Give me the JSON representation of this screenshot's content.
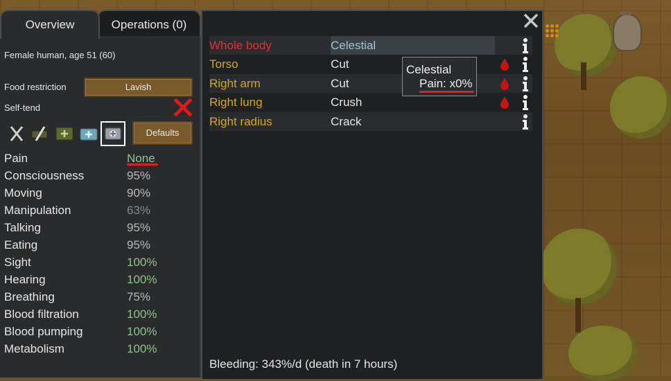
{
  "tabs": {
    "overview": "Overview",
    "operations": "Operations (0)"
  },
  "pawn": {
    "description": "Female human, age 51 (60)"
  },
  "food_restriction": {
    "label": "Food restriction",
    "value": "Lavish"
  },
  "self_tend": {
    "label": "Self-tend"
  },
  "medicine": {
    "icons": [
      "no-care-icon",
      "no-meds-icon",
      "herbal-medicine-icon",
      "industrial-medicine-icon",
      "glitterworld-medicine-icon"
    ],
    "defaults_label": "Defaults"
  },
  "capacities": [
    {
      "label": "Pain",
      "value": "None",
      "color": "#8fc28f"
    },
    {
      "label": "Consciousness",
      "value": "95%",
      "color": "#b8b8b8"
    },
    {
      "label": "Moving",
      "value": "90%",
      "color": "#b8b8b8"
    },
    {
      "label": "Manipulation",
      "value": "63%",
      "color": "#8a8a8a"
    },
    {
      "label": "Talking",
      "value": "95%",
      "color": "#b8b8b8"
    },
    {
      "label": "Eating",
      "value": "95%",
      "color": "#b8b8b8"
    },
    {
      "label": "Sight",
      "value": "100%",
      "color": "#8fc28f"
    },
    {
      "label": "Hearing",
      "value": "100%",
      "color": "#8fc28f"
    },
    {
      "label": "Breathing",
      "value": "75%",
      "color": "#b8b8b8"
    },
    {
      "label": "Blood filtration",
      "value": "100%",
      "color": "#8fc28f"
    },
    {
      "label": "Blood pumping",
      "value": "100%",
      "color": "#8fc28f"
    },
    {
      "label": "Metabolism",
      "value": "100%",
      "color": "#8fc28f"
    }
  ],
  "health": {
    "rows": [
      {
        "part": "Whole body",
        "condition": "Celestial",
        "part_color": "#e03030",
        "bleeding": false
      },
      {
        "part": "Torso",
        "condition": "Cut",
        "part_color": "#d4a81c",
        "bleeding": true
      },
      {
        "part": "Right arm",
        "condition": "Cut",
        "part_color": "#d4a81c",
        "bleeding": true
      },
      {
        "part": "Right lung",
        "condition": "Crush",
        "part_color": "#d4a81c",
        "bleeding": true
      },
      {
        "part": "Right radius",
        "condition": "Crack",
        "part_color": "#d4a81c",
        "bleeding": false
      }
    ],
    "tooltip": {
      "title": "Celestial",
      "line": "Pain: x0%"
    },
    "bleeding_status": "Bleeding: 343%/d (death in 7 hours)"
  }
}
